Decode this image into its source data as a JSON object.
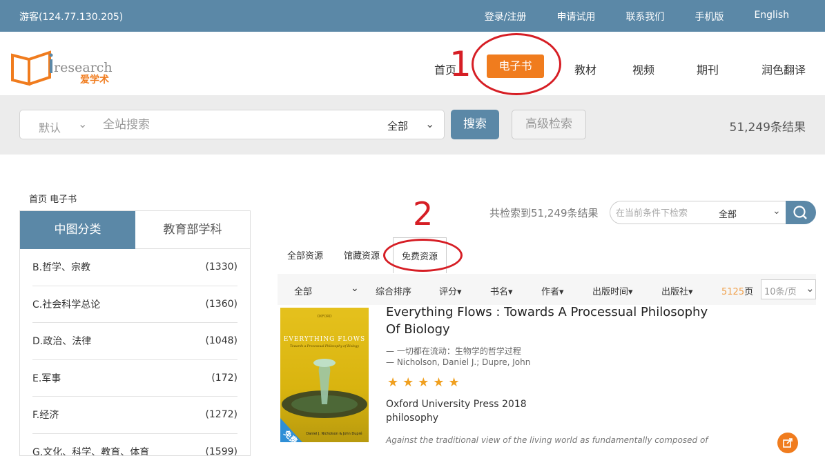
{
  "topbar": {
    "guest": "游客(124.77.130.205)",
    "links": [
      "登录/注册",
      "申请试用",
      "联系我们",
      "手机版",
      "English"
    ]
  },
  "logo": {
    "text_en": "research",
    "text_cn": "爱学术"
  },
  "nav": {
    "home": "首页",
    "ebook": "电子书",
    "textbook": "教材",
    "video": "视频",
    "journal": "期刊",
    "polish": "润色翻译"
  },
  "annotations": {
    "one": "1",
    "two": "2"
  },
  "search": {
    "mode": "默认",
    "placeholder": "全站搜索",
    "scope": "全部",
    "search_btn": "搜索",
    "advanced_btn": "高级检索",
    "result_count": "51,249条结果"
  },
  "breadcrumb": "首页 电子书",
  "sidebar": {
    "tab_active": "中图分类",
    "tab_inactive": "教育部学科",
    "categories": [
      {
        "name": "B.哲学、宗教",
        "count": "(1330)"
      },
      {
        "name": "C.社会科学总论",
        "count": "(1360)"
      },
      {
        "name": "D.政治、法律",
        "count": "(1048)"
      },
      {
        "name": "E.军事",
        "count": "(172)"
      },
      {
        "name": "F.经济",
        "count": "(1272)"
      },
      {
        "name": "G.文化、科学、教育、体育",
        "count": "(1599)"
      }
    ]
  },
  "results": {
    "total_line": "共检索到51,249条结果",
    "filter_placeholder": "在当前条件下检索",
    "filter_scope": "全部",
    "tabs": [
      "全部资源",
      "馆藏资源",
      "免费资源"
    ],
    "sort": {
      "all": "全部",
      "relevance": "综合排序",
      "rating": "评分",
      "title": "书名",
      "author": "作者",
      "date": "出版时间",
      "publisher": "出版社",
      "pages": "5125",
      "pages_unit": "页",
      "per_page": "10条/页"
    }
  },
  "book": {
    "title": "Everything Flows : Towards A Processual Philosophy Of Biology",
    "title_cn": "— 一切都在流动：生物学的哲学过程",
    "authors": "— Nicholson, Daniel J.; Dupre, John",
    "stars": "★★★★★",
    "rating": 5,
    "publisher": "Oxford University Press 2018",
    "subject": "philosophy",
    "abstract": "Against the traditional view of the living world as fundamentally composed of",
    "cover_publisher": "OXFORD",
    "cover_title": "EVERYTHING FLOWS",
    "cover_subtitle": "Towards a Processual Philosophy of Biology",
    "cover_authors": "Daniel J. Nicholson & John Dupré",
    "free_badge": "免费"
  },
  "colors": {
    "primary": "#5b88a7",
    "accent": "#f07c1e",
    "annotation": "#d61e25",
    "star": "#f0a020"
  }
}
